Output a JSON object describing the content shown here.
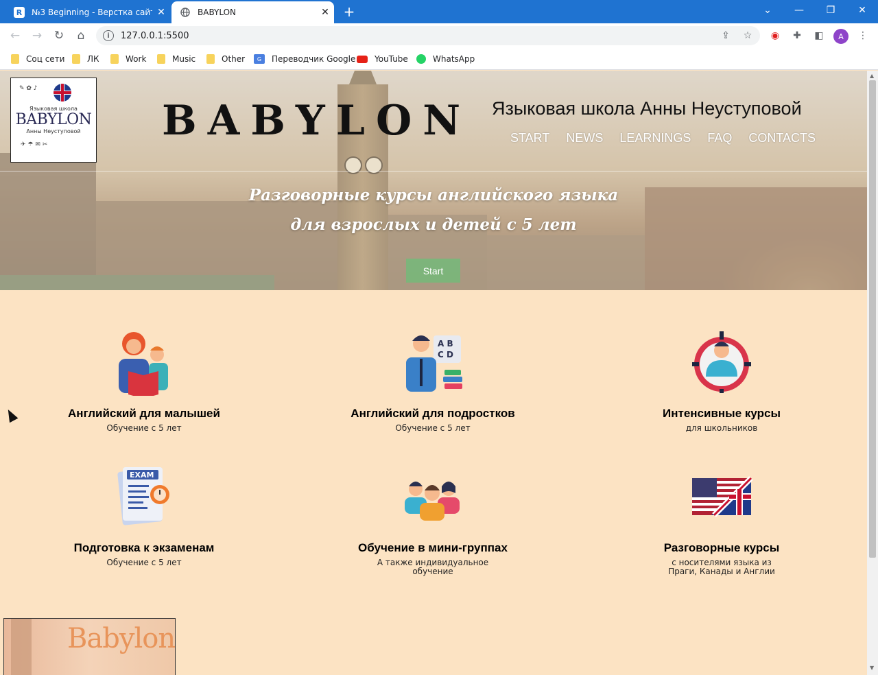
{
  "browser": {
    "tabs": [
      {
        "favicon": "R",
        "title": "№3 Beginning - Верстка сайта д...",
        "active": false
      },
      {
        "favicon": "globe-icon",
        "title": "BABYLON",
        "active": true
      }
    ],
    "url": "127.0.0.1:5500",
    "profile_initial": "A",
    "bookmarks": [
      "Соц сети",
      "ЛК",
      "Work",
      "Music",
      "Other",
      "Переводчик Google",
      "YouTube",
      "WhatsApp"
    ]
  },
  "header": {
    "logo": {
      "line1": "Языковая школа",
      "line2": "BABYLON",
      "line3": "Анны Неуступовой"
    },
    "brand": "BABYLON",
    "school_title": "Языковая школа Анны Неуступовой",
    "nav": [
      "START",
      "NEWS",
      "LEARNINGS",
      "FAQ",
      "CONTACTS"
    ],
    "tagline_line1": "Разговорные курсы английского языка",
    "tagline_line2": "для взрослых и детей с 5 лет",
    "start_button": "Start"
  },
  "features": [
    {
      "icon": "mother-child-reading-icon",
      "title": "Английский для малышей",
      "subtitle": "Обучение с 5 лет"
    },
    {
      "icon": "teacher-abcd-icon",
      "title": "Английский для подростков",
      "subtitle": "Обучение с 5 лет"
    },
    {
      "icon": "target-person-icon",
      "title": "Интенсивные курсы",
      "subtitle": "для школьников"
    },
    {
      "icon": "exam-paper-icon",
      "title": "Подготовка к экзаменам",
      "subtitle": "Обучение с 5 лет"
    },
    {
      "icon": "group-people-icon",
      "title": "Обучение в мини-группах",
      "subtitle": "А также индивидуальное обучение"
    },
    {
      "icon": "us-uk-flag-icon",
      "title": "Разговорные курсы",
      "subtitle": "с носителями языка из Праги, Канады и Англии"
    }
  ],
  "promo": {
    "word": "Babylon"
  },
  "colors": {
    "tabbar": "#1f73d1",
    "page_bg": "#fce3c3",
    "start_button": "#6ebe78"
  }
}
